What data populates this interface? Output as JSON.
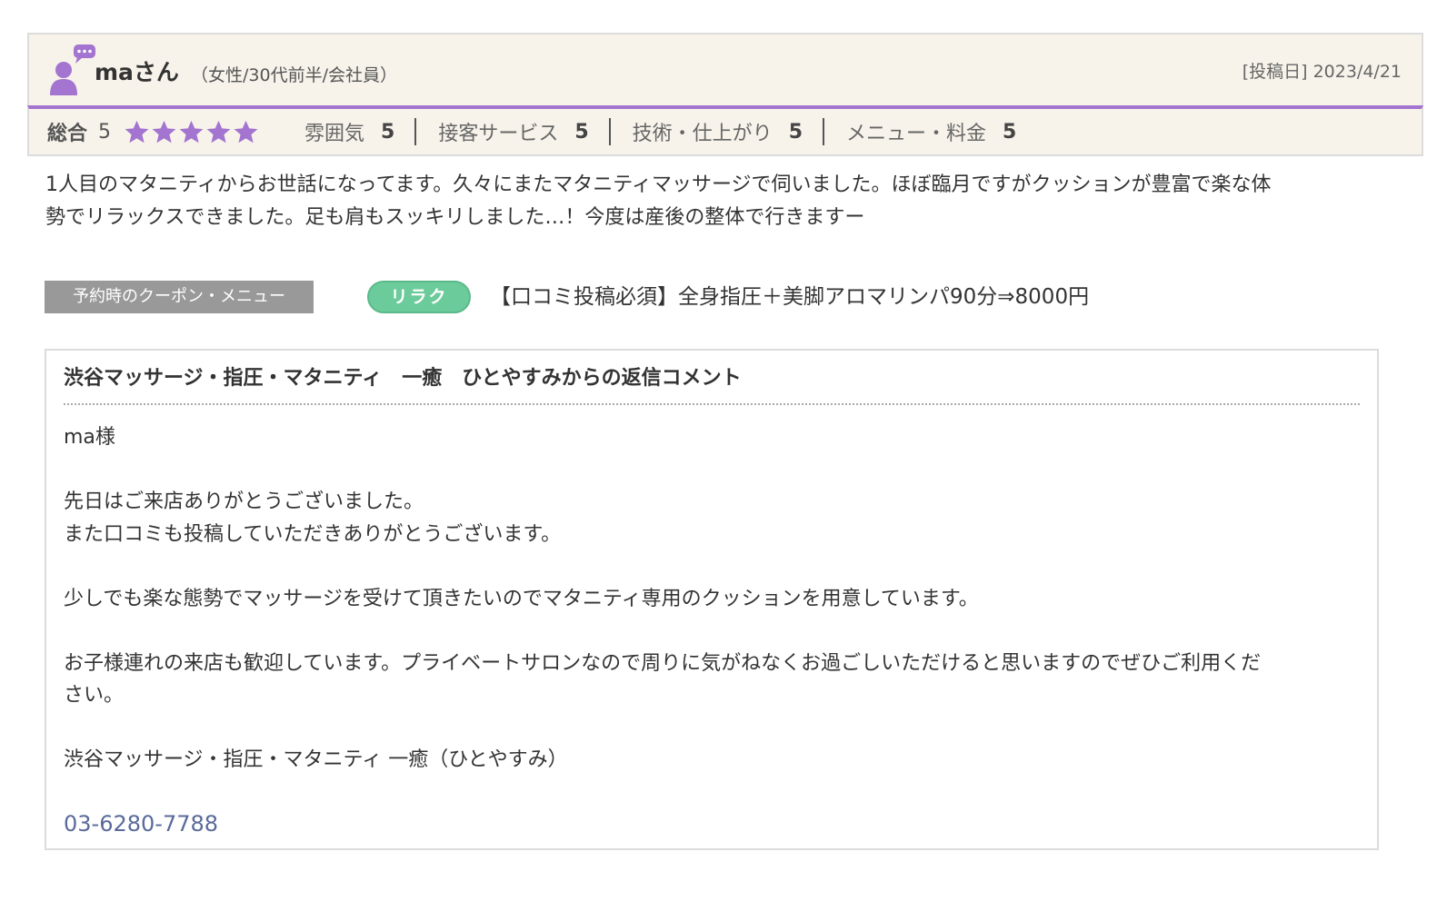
{
  "review": {
    "user_name": "maさん",
    "user_attrs": "（女性/30代前半/会社員）",
    "post_date": "[投稿日] 2023/4/21",
    "colors": {
      "accent": "#a374d0",
      "star": "#a374d0",
      "header_bg": "#f7f3ea"
    },
    "rating": {
      "total_label": "総合",
      "total_value": "5",
      "stars": 5,
      "categories": [
        {
          "label": "雰囲気",
          "value": "5"
        },
        {
          "label": "接客サービス",
          "value": "5"
        },
        {
          "label": "技術・仕上がり",
          "value": "5"
        },
        {
          "label": "メニュー・料金",
          "value": "5"
        }
      ]
    },
    "body_lines": [
      "1人目のマタニティからお世話になってます。久々にまたマタニティマッサージで伺いました。ほぼ臨月ですがクッションが豊富で楽な体",
      "勢でリラックスできました。足も肩もスッキリしました…！今度は産後の整体で行きますー"
    ]
  },
  "menu": {
    "tag": "予約時のクーポン・メニュー",
    "badge": "リラク",
    "name": "【口コミ投稿必須】全身指圧＋美脚アロマリンパ90分⇒8000円"
  },
  "reply": {
    "title": "渋谷マッサージ・指圧・マタニティ　一癒　ひとやすみからの返信コメント",
    "greeting": "ma様",
    "para1_line1": "先日はご来店ありがとうございました。",
    "para1_line2": "また口コミも投稿していただきありがとうございます。",
    "para2": "少しでも楽な態勢でマッサージを受けて頂きたいのでマタニティ専用のクッションを用意しています。",
    "para3_line1": "お子様連れの来店も歓迎しています。プライベートサロンなので周りに気がねなくお過ごしいただけると思いますのでぜひご利用くだ",
    "para3_line2": "さい。",
    "signature": "渋谷マッサージ・指圧・マタニティ 一癒（ひとやすみ）",
    "phone": "03-6280-7788"
  }
}
